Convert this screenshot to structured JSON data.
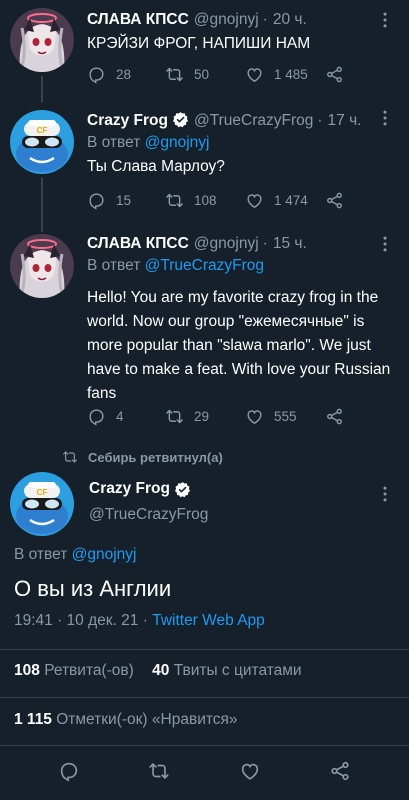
{
  "tweets": [
    {
      "name": "СЛАВА КПСС",
      "handle": "@gnojnyj",
      "dot": "·",
      "time": "20 ч.",
      "text": "КРЭЙЗИ ФРОГ, НАПИШИ НАМ",
      "replies": "28",
      "retweets": "50",
      "likes": "1 485"
    },
    {
      "name": "Crazy Frog",
      "handle": "@TrueCrazyFrog",
      "dot": "·",
      "time": "17 ч.",
      "reply_prefix": "В ответ",
      "reply_handle": "@gnojnyj",
      "text": "Ты Слава Марлоу?",
      "replies": "15",
      "retweets": "108",
      "likes": "1 474"
    },
    {
      "name": "СЛАВА КПСС",
      "handle": "@gnojnyj",
      "dot": "·",
      "time": "15 ч.",
      "reply_prefix": "В ответ",
      "reply_handle": "@TrueCrazyFrog",
      "text": "Hello! You are my favorite crazy frog in the world. Now our group \"ежемесячные\" is more popular than \"slawa marlo\". We just have to make a feat. With love your Russian fans",
      "replies": "4",
      "retweets": "29",
      "likes": "555"
    }
  ],
  "retweeted_by": "Себирь ретвитнул(а)",
  "focus": {
    "name": "Crazy Frog",
    "handle": "@TrueCrazyFrog",
    "reply_prefix": "В ответ",
    "reply_handle": "@gnojnyj",
    "text": "О вы из Англии",
    "datetime": "19:41 · 10 дек. 21 ·",
    "app": "Twitter Web App",
    "retweets_count": "108",
    "retweets_label": "Ретвита(-ов)",
    "quotes_count": "40",
    "quotes_label": "Твиты с цитатами",
    "likes_count": "1 115",
    "likes_label": "Отметки(-ок) «Нравится»"
  },
  "colors": {
    "background": "#15202b",
    "muted": "#8b98a5",
    "link": "#1d9bf0",
    "divider": "#38444d"
  },
  "icons": [
    "reply-icon",
    "retweet-icon",
    "like-icon",
    "share-icon",
    "verified-icon",
    "more-icon"
  ]
}
